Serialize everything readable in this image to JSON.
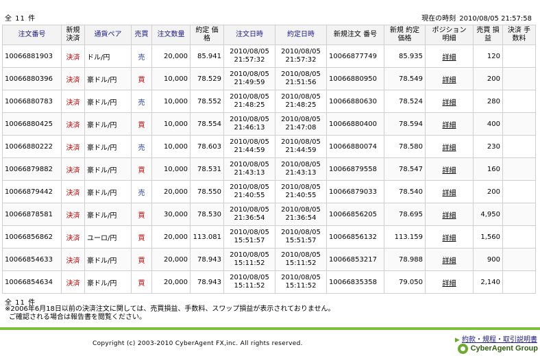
{
  "header": {
    "total_count": "全 11 件",
    "current_time_label": "現在の時刻",
    "current_time_value": "2010/08/05 21:57:58"
  },
  "table": {
    "columns": {
      "order_no": "注文番号",
      "new_settle": "新規 決済",
      "pair": "通貨ペア",
      "side": "売買",
      "qty": "注文数量",
      "contract_price": "約定 価格",
      "order_datetime": "注文日時",
      "contract_datetime": "約定日時",
      "new_order_no": "新規注文 番号",
      "new_contract_price": "新規 約定価格",
      "position_detail": "ポジション 明細",
      "pnl": "売買 損益",
      "fee": "決済 手数料"
    },
    "rows": [
      {
        "order_no": "10066881903",
        "type": "決済",
        "pair": "ドル/円",
        "side": "売",
        "qty": "20,000",
        "price": "85.941",
        "order_date": "2010/08/05",
        "order_time": "21:57:32",
        "contract_date": "2010/08/05",
        "contract_time": "21:57:32",
        "new_order_no": "10066877749",
        "new_price": "85.935",
        "detail": "詳細",
        "pnl": "120",
        "fee": ""
      },
      {
        "order_no": "10066880396",
        "type": "決済",
        "pair": "豪ドル/円",
        "side": "買",
        "qty": "10,000",
        "price": "78.529",
        "order_date": "2010/08/05",
        "order_time": "21:49:59",
        "contract_date": "2010/08/05",
        "contract_time": "21:51:56",
        "new_order_no": "10066880950",
        "new_price": "78.549",
        "detail": "詳細",
        "pnl": "200",
        "fee": ""
      },
      {
        "order_no": "10066880783",
        "type": "決済",
        "pair": "豪ドル/円",
        "side": "売",
        "qty": "10,000",
        "price": "78.552",
        "order_date": "2010/08/05",
        "order_time": "21:48:25",
        "contract_date": "2010/08/05",
        "contract_time": "21:48:25",
        "new_order_no": "10066880630",
        "new_price": "78.524",
        "detail": "詳細",
        "pnl": "280",
        "fee": ""
      },
      {
        "order_no": "10066880425",
        "type": "決済",
        "pair": "豪ドル/円",
        "side": "買",
        "qty": "10,000",
        "price": "78.554",
        "order_date": "2010/08/05",
        "order_time": "21:46:13",
        "contract_date": "2010/08/05",
        "contract_time": "21:47:08",
        "new_order_no": "10066880400",
        "new_price": "78.594",
        "detail": "詳細",
        "pnl": "400",
        "fee": ""
      },
      {
        "order_no": "10066880222",
        "type": "決済",
        "pair": "豪ドル/円",
        "side": "売",
        "qty": "10,000",
        "price": "78.603",
        "order_date": "2010/08/05",
        "order_time": "21:44:59",
        "contract_date": "2010/08/05",
        "contract_time": "21:44:59",
        "new_order_no": "10066880074",
        "new_price": "78.580",
        "detail": "詳細",
        "pnl": "230",
        "fee": ""
      },
      {
        "order_no": "10066879882",
        "type": "決済",
        "pair": "豪ドル/円",
        "side": "買",
        "qty": "10,000",
        "price": "78.531",
        "order_date": "2010/08/05",
        "order_time": "21:43:13",
        "contract_date": "2010/08/05",
        "contract_time": "21:43:13",
        "new_order_no": "10066879558",
        "new_price": "78.547",
        "detail": "詳細",
        "pnl": "160",
        "fee": ""
      },
      {
        "order_no": "10066879442",
        "type": "決済",
        "pair": "豪ドル/円",
        "side": "売",
        "qty": "20,000",
        "price": "78.550",
        "order_date": "2010/08/05",
        "order_time": "21:40:55",
        "contract_date": "2010/08/05",
        "contract_time": "21:40:55",
        "new_order_no": "10066879033",
        "new_price": "78.540",
        "detail": "詳細",
        "pnl": "200",
        "fee": ""
      },
      {
        "order_no": "10066878581",
        "type": "決済",
        "pair": "豪ドル/円",
        "side": "買",
        "qty": "30,000",
        "price": "78.530",
        "order_date": "2010/08/05",
        "order_time": "21:36:54",
        "contract_date": "2010/08/05",
        "contract_time": "21:36:54",
        "new_order_no": "10066856205",
        "new_price": "78.695",
        "detail": "詳細",
        "pnl": "4,950",
        "fee": ""
      },
      {
        "order_no": "10066856862",
        "type": "決済",
        "pair": "ユーロ/円",
        "side": "買",
        "qty": "20,000",
        "price": "113.081",
        "order_date": "2010/08/05",
        "order_time": "15:51:57",
        "contract_date": "2010/08/05",
        "contract_time": "15:51:57",
        "new_order_no": "10066856132",
        "new_price": "113.159",
        "detail": "詳細",
        "pnl": "1,560",
        "fee": ""
      },
      {
        "order_no": "10066854633",
        "type": "決済",
        "pair": "豪ドル/円",
        "side": "買",
        "qty": "20,000",
        "price": "78.943",
        "order_date": "2010/08/05",
        "order_time": "15:11:52",
        "contract_date": "2010/08/05",
        "contract_time": "15:11:52",
        "new_order_no": "10066853217",
        "new_price": "78.988",
        "detail": "詳細",
        "pnl": "900",
        "fee": ""
      },
      {
        "order_no": "10066854634",
        "type": "決済",
        "pair": "豪ドル/円",
        "side": "買",
        "qty": "20,000",
        "price": "78.943",
        "order_date": "2010/08/05",
        "order_time": "15:11:52",
        "contract_date": "2010/08/05",
        "contract_time": "15:11:52",
        "new_order_no": "10066835358",
        "new_price": "79.050",
        "detail": "詳細",
        "pnl": "2,140",
        "fee": ""
      }
    ]
  },
  "footer": {
    "total_count": "全 11 件",
    "note1": "※2006年6月18日以前の決済注文に関しては、売買損益、手数料、スワップ損益が表示されておりません。",
    "note2": "ご確認される場合は報告書を閲覧ください。",
    "copyright": "Copyright (c) 2003-2010 CyberAgent FX,inc. All rights reserved.",
    "terms_link": "約款・規程・取引説明書",
    "brand": "CyberAgent Group"
  },
  "colors": {
    "settle_red": "#cc0000",
    "sell_blue": "#1e3fa8",
    "buy_red": "#cc0000",
    "header_blue": "#1a1a8c",
    "accent_green": "#7fbf3a"
  }
}
